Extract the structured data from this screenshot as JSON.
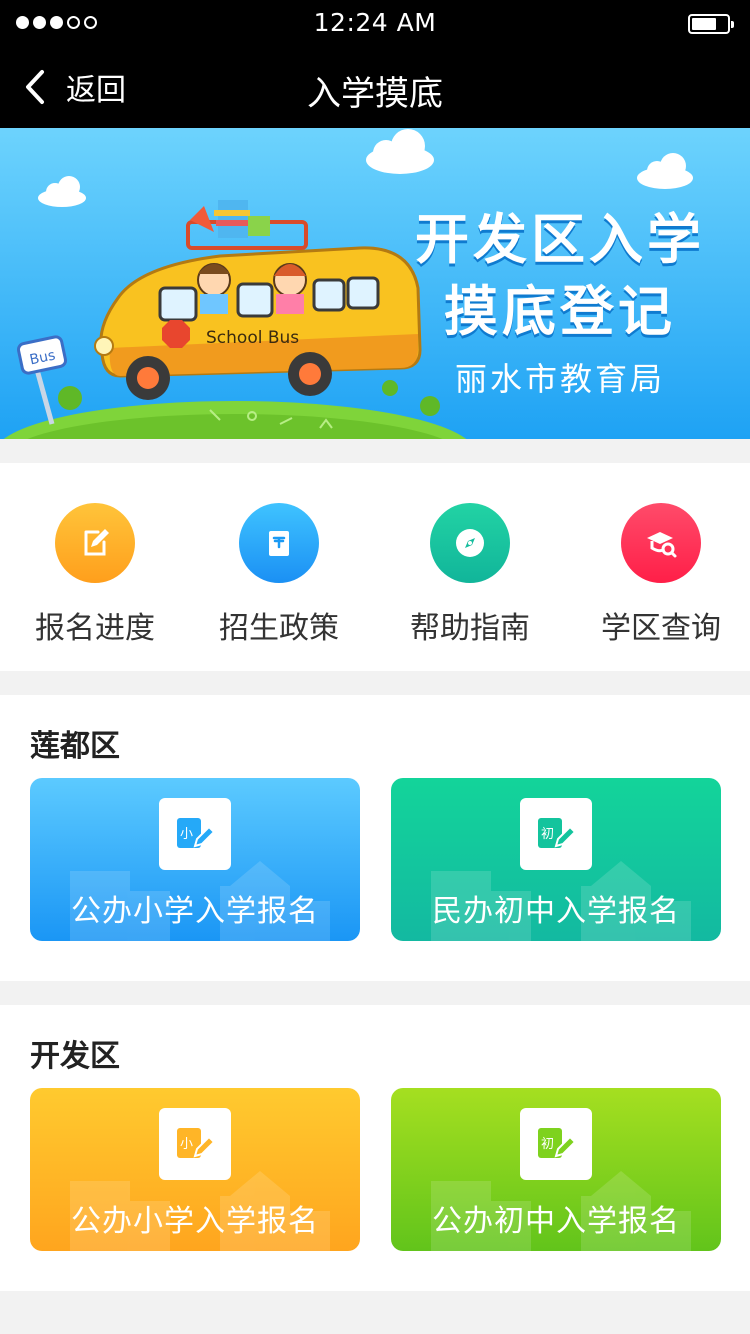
{
  "status_bar": {
    "time": "12:24 AM",
    "signal_dots_filled": 3,
    "signal_dots_total": 5,
    "battery_level": 0.7
  },
  "nav": {
    "back_label": "返回",
    "title": "入学摸底"
  },
  "banner": {
    "line1": "开发区入学",
    "line2": "摸底登记",
    "line3": "丽水市教育局",
    "bus_text": "School Bus",
    "sign_text": "Bus"
  },
  "quick_menu": [
    {
      "label": "报名进度",
      "icon": "edit-icon",
      "color_from": "#ffc43a",
      "color_to": "#ff9f1c"
    },
    {
      "label": "招生政策",
      "icon": "policy-book-icon",
      "color_from": "#3fc3ff",
      "color_to": "#1b90f4"
    },
    {
      "label": "帮助指南",
      "icon": "compass-icon",
      "color_from": "#22d3a4",
      "color_to": "#11b59a"
    },
    {
      "label": "学区查询",
      "icon": "graduation-search-icon",
      "color_from": "#ff4b6a",
      "color_to": "#ff1f48"
    }
  ],
  "sections": [
    {
      "title": "莲都区",
      "cards": [
        {
          "label": "公办小学入学报名",
          "badge": "小",
          "color": "#25a9f8"
        },
        {
          "label": "民办初中入学报名",
          "badge": "初",
          "color": "#13c49d"
        }
      ]
    },
    {
      "title": "开发区",
      "cards": [
        {
          "label": "公办小学入学报名",
          "badge": "小",
          "color": "#ffb527"
        },
        {
          "label": "公办初中入学报名",
          "badge": "初",
          "color": "#7ed21e"
        }
      ]
    }
  ]
}
